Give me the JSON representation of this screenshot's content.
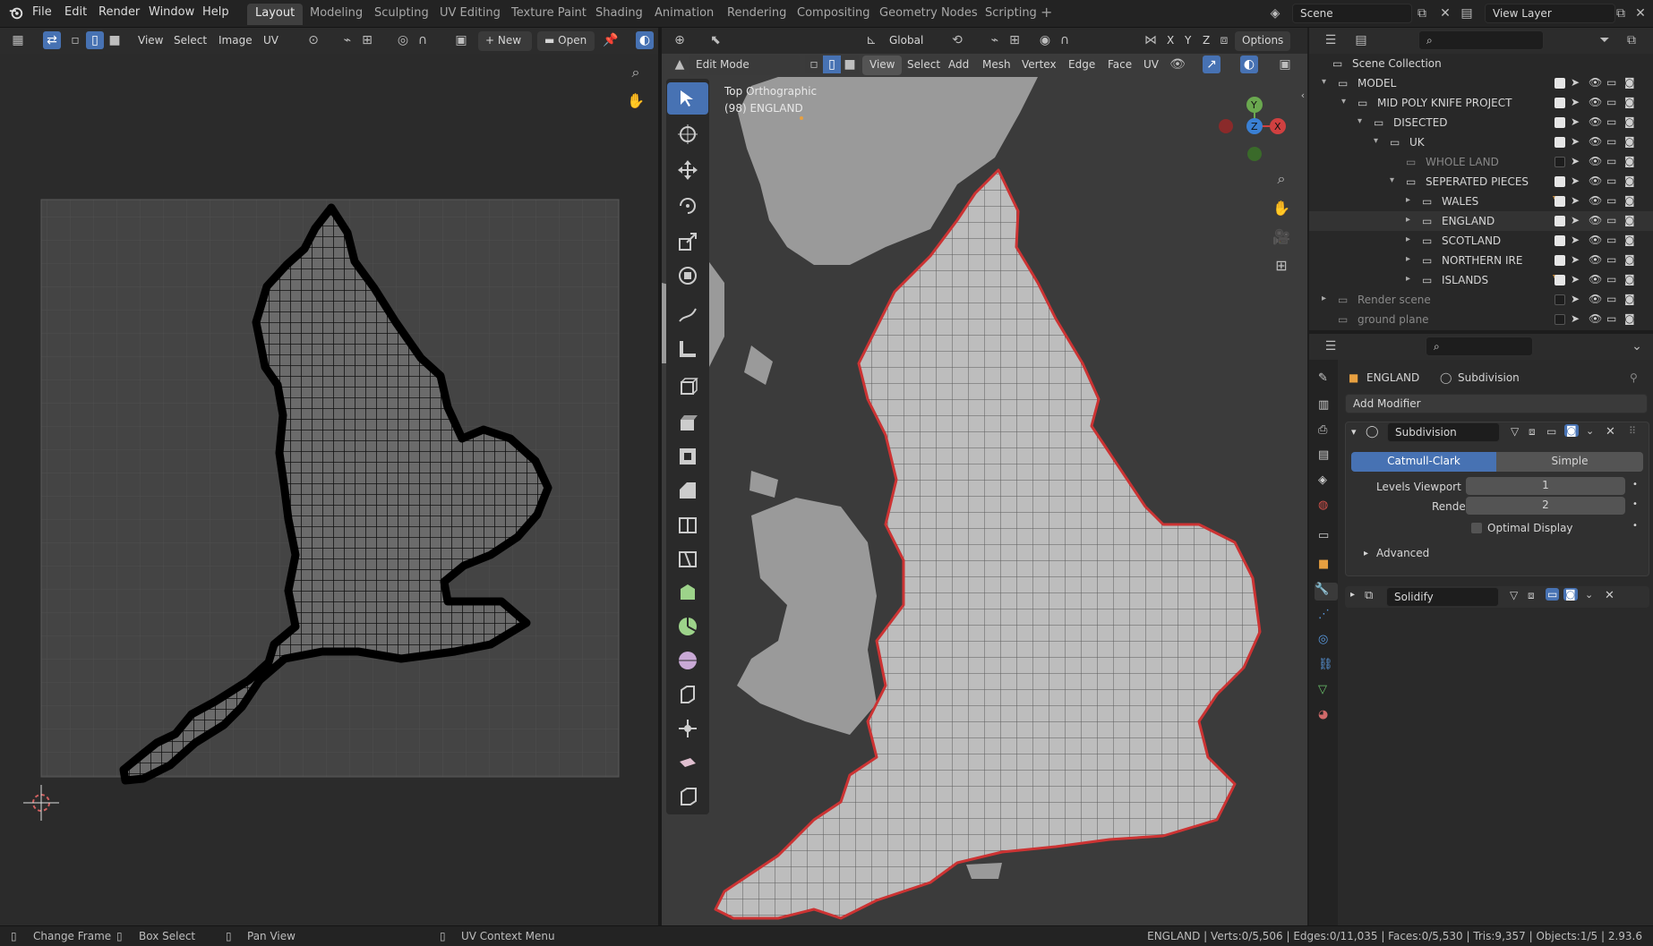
{
  "top_menu": {
    "file": "File",
    "edit": "Edit",
    "render": "Render",
    "window": "Window",
    "help": "Help"
  },
  "workspaces": [
    "Layout",
    "Modeling",
    "Sculpting",
    "UV Editing",
    "Texture Paint",
    "Shading",
    "Animation",
    "Rendering",
    "Compositing",
    "Geometry Nodes",
    "Scripting"
  ],
  "scene": {
    "scene_name": "Scene",
    "view_layer": "View Layer"
  },
  "uv_editor": {
    "header": {
      "view": "View",
      "select": "Select",
      "image": "Image",
      "uv": "UV",
      "new": "New",
      "open": "Open"
    }
  },
  "viewport": {
    "header": {
      "mode": "Edit Mode",
      "view": "View",
      "select": "Select",
      "add": "Add",
      "mesh": "Mesh",
      "vertex": "Vertex",
      "edge": "Edge",
      "face": "Face",
      "uv": "UV",
      "transform": "Global",
      "options": "Options",
      "axis_x": "X",
      "axis_y": "Y",
      "axis_z": "Z"
    },
    "overlay_title": "Top Orthographic",
    "overlay_sub": "(98) ENGLAND",
    "gizmo": {
      "y": "Y",
      "z": "Z",
      "x": "X"
    }
  },
  "outliner": {
    "title": "Scene Collection",
    "rows": [
      {
        "label": "MODEL",
        "checked": true
      },
      {
        "label": "MID POLY KNIFE PROJECT",
        "checked": true
      },
      {
        "label": "DISECTED",
        "checked": true
      },
      {
        "label": "UK",
        "checked": true
      },
      {
        "label": "WHOLE LAND",
        "checked": false
      },
      {
        "label": "SEPERATED PIECES",
        "checked": true
      },
      {
        "label": "WALES",
        "checked": true
      },
      {
        "label": "ENGLAND",
        "checked": true
      },
      {
        "label": "SCOTLAND",
        "checked": true
      },
      {
        "label": "NORTHERN IRE",
        "checked": true
      },
      {
        "label": "ISLANDS",
        "checked": true
      },
      {
        "label": "Render scene",
        "checked": false
      },
      {
        "label": "ground plane",
        "checked": false
      }
    ]
  },
  "properties": {
    "object": "ENGLAND",
    "modifier_tab": "Subdivision",
    "add_modifier": "Add Modifier",
    "subdivision": {
      "name": "Subdivision",
      "catmull": "Catmull-Clark",
      "simple": "Simple",
      "levels_label": "Levels Viewport",
      "levels_value": "1",
      "render_label": "Render",
      "render_value": "2",
      "optimal": "Optimal Display",
      "advanced": "Advanced"
    },
    "solidify": {
      "name": "Solidify"
    }
  },
  "status_bar": {
    "change_frame": "Change Frame",
    "box_select": "Box Select",
    "pan_view": "Pan View",
    "uv_menu": "UV Context Menu",
    "stats": "ENGLAND | Verts:0/5,506 | Edges:0/11,035 | Faces:0/5,530 | Tris:9,357 | Objects:1/5 | 2.93.6"
  },
  "colors": {
    "accent": "#4772b3",
    "selection_red": "#d04040",
    "mesh_fill": "#b8b8b8",
    "land": "#9a9a9a",
    "sea": "#3d3d3d"
  }
}
